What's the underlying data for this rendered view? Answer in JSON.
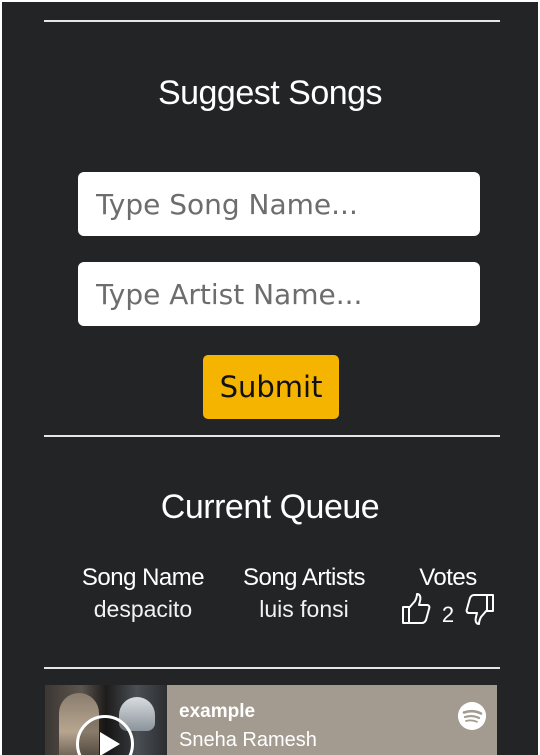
{
  "suggest": {
    "title": "Suggest Songs",
    "song_placeholder": "Type Song Name...",
    "artist_placeholder": "Type Artist Name...",
    "submit_label": "Submit"
  },
  "queue": {
    "title": "Current Queue",
    "headers": {
      "song": "Song Name",
      "artists": "Song Artists",
      "votes": "Votes"
    },
    "rows": [
      {
        "song": "despacito",
        "artists": "luis fonsi",
        "votes": "2"
      }
    ]
  },
  "player": {
    "track": "example",
    "artist": "Sneha Ramesh",
    "icon": "spotify-icon"
  },
  "colors": {
    "background": "#222426",
    "accent": "#f5b400",
    "player_bg": "#a39b8f"
  }
}
